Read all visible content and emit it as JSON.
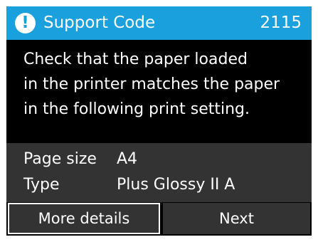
{
  "header": {
    "icon": "alert-icon",
    "icon_glyph": "!",
    "title": "Support Code",
    "code": "2115",
    "color": "#1aa0dc"
  },
  "message": {
    "lines": [
      "Check that the paper loaded",
      "in the printer matches the paper",
      "in the following print setting."
    ]
  },
  "settings": {
    "rows": [
      {
        "label": "Page size",
        "value": "A4"
      },
      {
        "label": "Type",
        "value": "Plus Glossy II A"
      }
    ]
  },
  "buttons": {
    "more_details": "More details",
    "next": "Next"
  },
  "colors": {
    "screen_background": "#000000",
    "panel_background": "#333333",
    "text": "#ffffff"
  }
}
